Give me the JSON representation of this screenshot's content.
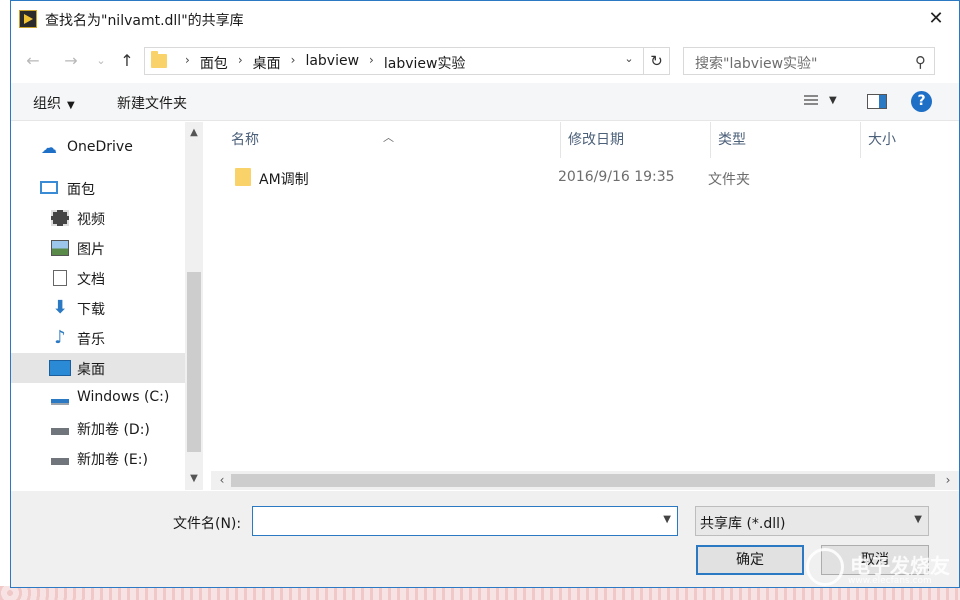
{
  "window": {
    "title": "查找名为\"nilvamt.dll\"的共享库",
    "close_glyph": "✕"
  },
  "address": {
    "back": "←",
    "forward": "→",
    "recent": "⌄",
    "up": "↑",
    "crumbs": [
      "面包",
      "桌面",
      "labview",
      "labview实验"
    ],
    "separator": "›",
    "dropdown": "⌄",
    "refresh": "↻"
  },
  "search": {
    "placeholder": "搜索\"labview实验\"",
    "icon": "⚲"
  },
  "toolbar": {
    "organize": "组织",
    "organize_caret": "▼",
    "new_folder": "新建文件夹",
    "view_caret": "▼",
    "help": "?"
  },
  "nav": {
    "items": [
      {
        "label": "OneDrive",
        "icon": "cloud-icon"
      },
      {
        "label": "面包",
        "icon": "computer-icon"
      },
      {
        "label": "视频",
        "icon": "video-icon"
      },
      {
        "label": "图片",
        "icon": "picture-icon"
      },
      {
        "label": "文档",
        "icon": "document-icon"
      },
      {
        "label": "下载",
        "icon": "download-icon"
      },
      {
        "label": "音乐",
        "icon": "music-icon"
      },
      {
        "label": "桌面",
        "icon": "desktop-icon"
      },
      {
        "label": "Windows (C:)",
        "icon": "drive-icon"
      },
      {
        "label": "新加卷 (D:)",
        "icon": "drive-icon"
      },
      {
        "label": "新加卷 (E:)",
        "icon": "drive-icon"
      }
    ],
    "selected": "桌面"
  },
  "columns": {
    "name": "名称",
    "date": "修改日期",
    "type": "类型",
    "size": "大小"
  },
  "files": [
    {
      "name": "AM调制",
      "date": "2016/9/16 19:35",
      "type": "文件夹"
    }
  ],
  "bottom": {
    "filename_label": "文件名(N):",
    "filename_value": "",
    "filter": "共享库 (*.dll)",
    "ok": "确定",
    "cancel": "取消"
  },
  "watermark": {
    "text": "电子发烧友",
    "url": "www.elecfans.com"
  },
  "colors": {
    "accent": "#2b79c2",
    "folder": "#f9d36a",
    "selected_bg": "#e5e5e5"
  }
}
